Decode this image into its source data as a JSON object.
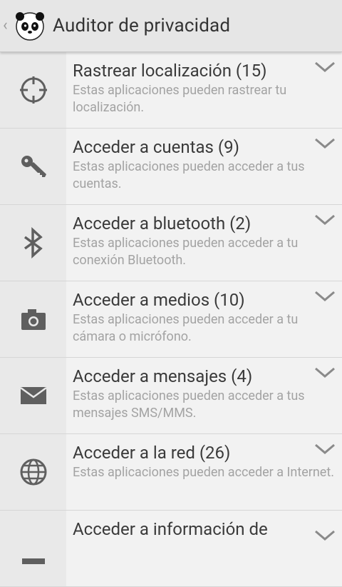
{
  "header": {
    "back_icon": "chevron-left-icon",
    "logo_icon": "panda-logo-icon",
    "title": "Auditor de privacidad"
  },
  "colors": {
    "icon_gray": "#5f5f5f",
    "chevron_gray": "#8a8a8a"
  },
  "items": [
    {
      "icon": "crosshair-icon",
      "title": "Rastrear localización (15)",
      "desc": "Estas aplicaciones pueden rastrear tu localización."
    },
    {
      "icon": "key-icon",
      "title": "Acceder a cuentas (9)",
      "desc": "Estas aplicaciones pueden acceder a tus cuentas."
    },
    {
      "icon": "bluetooth-icon",
      "title": "Acceder a bluetooth (2)",
      "desc": "Estas aplicaciones pueden acceder a tu conexión Bluetooth."
    },
    {
      "icon": "camera-icon",
      "title": "Acceder a medios (10)",
      "desc": "Estas aplicaciones pueden acceder a tu cámara o micrófono."
    },
    {
      "icon": "envelope-icon",
      "title": "Acceder a mensajes (4)",
      "desc": "Estas aplicaciones pueden acceder a tus mensajes SMS/MMS."
    },
    {
      "icon": "globe-icon",
      "title": "Acceder a la red (26)",
      "desc": "Estas aplicaciones pueden acceder a Internet."
    },
    {
      "icon": "id-card-icon",
      "title": "Acceder a información de",
      "desc": ""
    }
  ]
}
